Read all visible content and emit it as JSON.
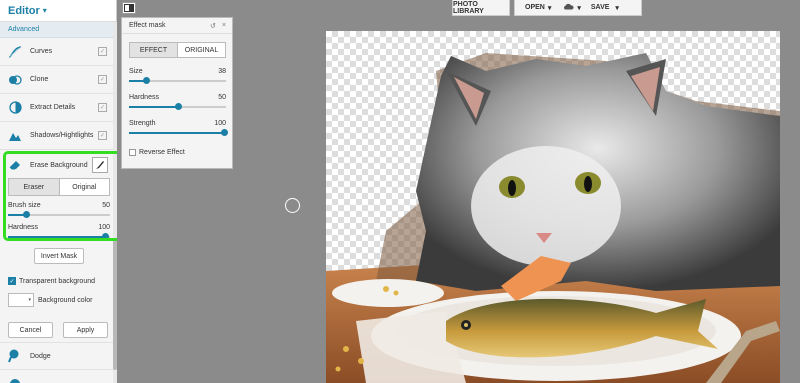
{
  "sidebar": {
    "title": "Editor",
    "section": "Advanced",
    "tools": [
      {
        "label": "Curves"
      },
      {
        "label": "Clone"
      },
      {
        "label": "Extract Details"
      },
      {
        "label": "Shadows/Hightlights"
      }
    ],
    "erase": {
      "label": "Erase Background",
      "mode_eraser": "Eraser",
      "mode_original": "Original",
      "brush_size_label": "Brush size",
      "brush_size_value": "50",
      "hardness_label": "Hardness",
      "hardness_value": "100",
      "brush_size_fraction": 0.18,
      "hardness_fraction": 0.95
    },
    "invert_mask": "Invert Mask",
    "transparent_bg": "Transparent background",
    "bg_color": "Background color",
    "cancel": "Cancel",
    "apply": "Apply",
    "next_tool": "Dodge"
  },
  "topbar": {
    "photo_library": "PHOTO LIBRARY",
    "open": "OPEN",
    "save": "SAVE"
  },
  "mask_panel": {
    "title": "Effect mask",
    "tab_effect": "EFFECT",
    "tab_original": "ORIGINAL",
    "size_label": "Size",
    "size_value": "38",
    "hardness_label": "Hardness",
    "hardness_value": "50",
    "strength_label": "Strength",
    "strength_value": "100",
    "reverse": "Reverse Effect",
    "size_fraction": 0.18,
    "hardness_fraction": 0.5,
    "strength_fraction": 0.98
  },
  "colors": {
    "accent": "#1b7fa6",
    "highlight": "#33dd22"
  }
}
